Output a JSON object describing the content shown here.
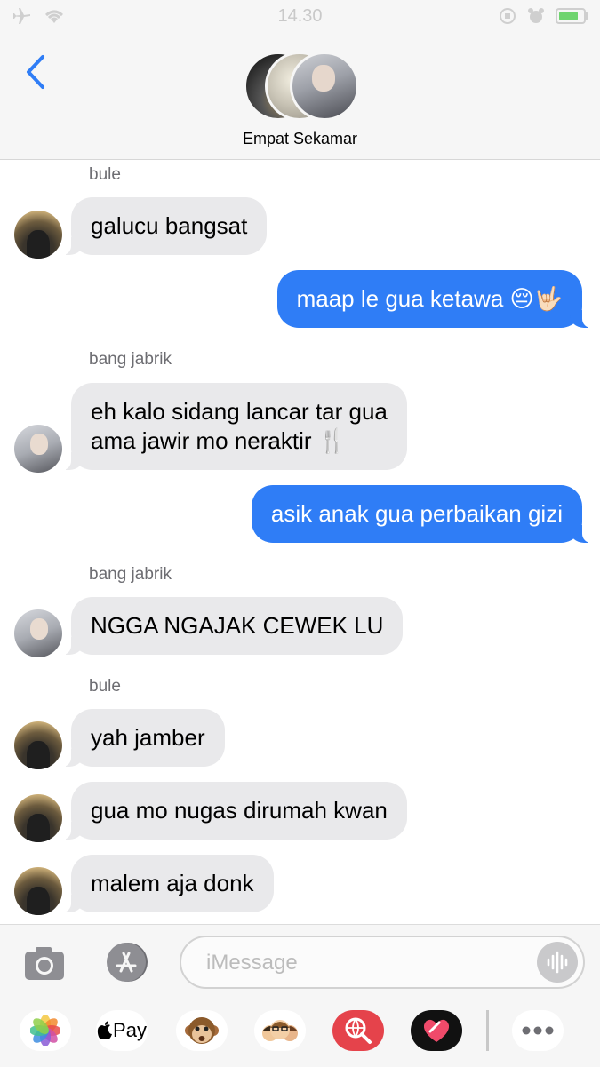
{
  "status_bar": {
    "time": "14.30"
  },
  "header": {
    "group_name": "Empat Sekamar"
  },
  "messages": [
    {
      "sender": "bule"
    },
    {
      "text": "galucu bangsat"
    },
    {
      "text": "maap le gua ketawa 😔🤟🏻"
    },
    {
      "sender": "bang jabrik"
    },
    {
      "text": "eh kalo sidang lancar tar gua\nama jawir mo neraktir 🍴"
    },
    {
      "text": "asik anak gua perbaikan gizi"
    },
    {
      "sender": "bang jabrik"
    },
    {
      "text": "NGGA NGAJAK CEWEK LU"
    },
    {
      "sender": "bule"
    },
    {
      "text": "yah jamber"
    },
    {
      "text": "gua mo nugas dirumah kwan"
    },
    {
      "text": "malem aja donk"
    }
  ],
  "input": {
    "placeholder": "iMessage"
  },
  "apps": {
    "apple_pay": "Pay"
  },
  "colors": {
    "outgoing": "#2f7df6",
    "incoming": "#e9e9eb"
  }
}
